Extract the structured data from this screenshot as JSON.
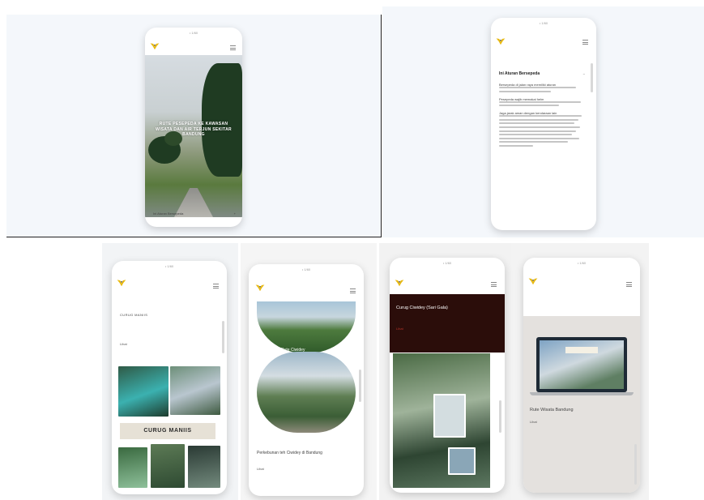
{
  "phone1": {
    "status": "• 1/60",
    "hero_title": "RUTE PESEPEDA KE KAWASAN WISATA DAN AIR TERJUN SEKITAR BANDUNG",
    "footer_label": "Ini Aturan Bersepeda",
    "footer_icon": "plus-icon"
  },
  "phone2": {
    "status": "• 1/60",
    "heading": "Ini Aturan Bersepeda",
    "para1": "Bersepeda di jalan raya memiliki aturan",
    "para2": "Pesepeda wajib memakai helm",
    "para3": "Jaga jarak aman dengan kendaraan lain"
  },
  "phone3": {
    "status": "• 1/60",
    "heading": "CURUG MANIIS",
    "link": "Lihat",
    "banner": "CURUG MANIIS"
  },
  "phone4": {
    "status": "• 1/60",
    "subtitle": "Rute Ciwidey",
    "caption": "Perkebunan teh Ciwidey di Bandung",
    "link": "Lihat"
  },
  "phone5": {
    "status": "• 1/60",
    "title": "Curug Ciwidey (Sari Gala)",
    "link": "Lihat"
  },
  "phone6": {
    "status": "• 1/60",
    "caption": "Rute Wisata Bandung",
    "link": "Lihat"
  },
  "colors": {
    "accent_red": "#b8342a",
    "dark_header": "#2b0d0a",
    "logo_yellow": "#e8b90f"
  }
}
